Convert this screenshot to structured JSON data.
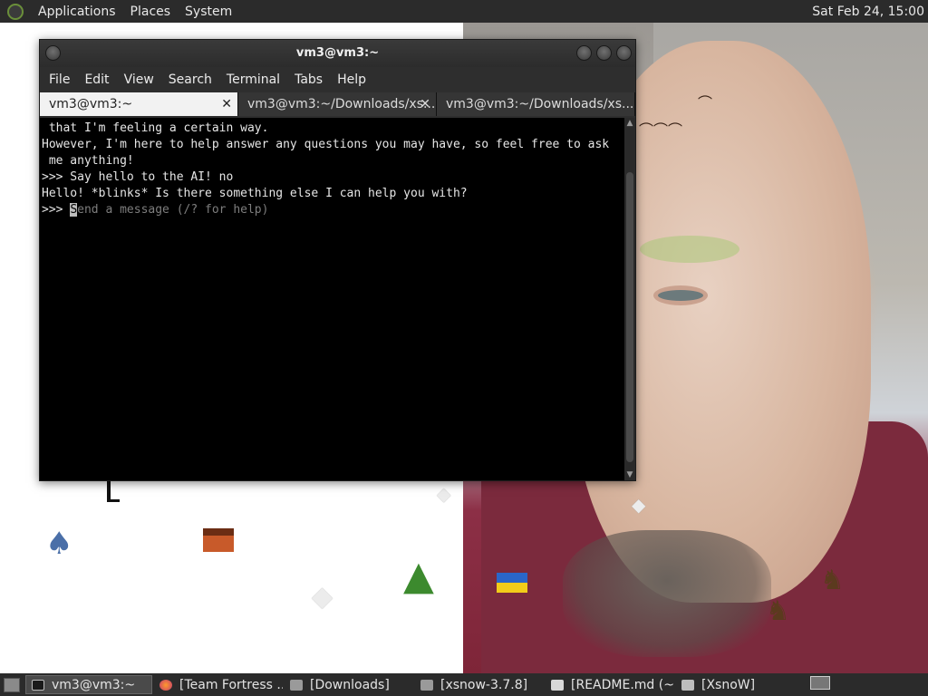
{
  "top_panel": {
    "menus": [
      "Applications",
      "Places",
      "System"
    ],
    "clock": "Sat Feb 24, 15:00"
  },
  "terminal": {
    "title": "vm3@vm3:~",
    "menu": [
      "File",
      "Edit",
      "View",
      "Search",
      "Terminal",
      "Tabs",
      "Help"
    ],
    "tabs": [
      {
        "label": "vm3@vm3:~",
        "active": true
      },
      {
        "label": "vm3@vm3:~/Downloads/xs...",
        "active": false
      },
      {
        "label": "vm3@vm3:~/Downloads/xs...",
        "active": false
      }
    ],
    "lines": [
      " that I'm feeling a certain way.",
      "However, I'm here to help answer any questions you may have, so feel free to ask",
      " me anything!",
      "",
      ">>> Say hello to the AI! no",
      "Hello! *blinks* Is there something else I can help you with?",
      "",
      ""
    ],
    "prompt": ">>> ",
    "input_placeholder": "Send a message (/? for help)"
  },
  "taskbar": {
    "items": [
      {
        "label": "vm3@vm3:~",
        "icon": "terminal-icon",
        "active": true
      },
      {
        "label": "[Team Fortress ...",
        "icon": "firefox-icon",
        "active": false
      },
      {
        "label": "[Downloads]",
        "icon": "folder-icon",
        "active": false
      },
      {
        "label": "[xsnow-3.7.8]",
        "icon": "folder-icon",
        "active": false
      },
      {
        "label": "[README.md (~...",
        "icon": "text-editor-icon",
        "active": false
      },
      {
        "label": "[XsnoW]",
        "icon": "window-icon",
        "active": false
      }
    ]
  },
  "colors": {
    "panel": "#2b2b2b",
    "terminal_bg": "#000000",
    "terminal_fg": "#e6e6e6",
    "active_tab": "#f2f2f2"
  }
}
